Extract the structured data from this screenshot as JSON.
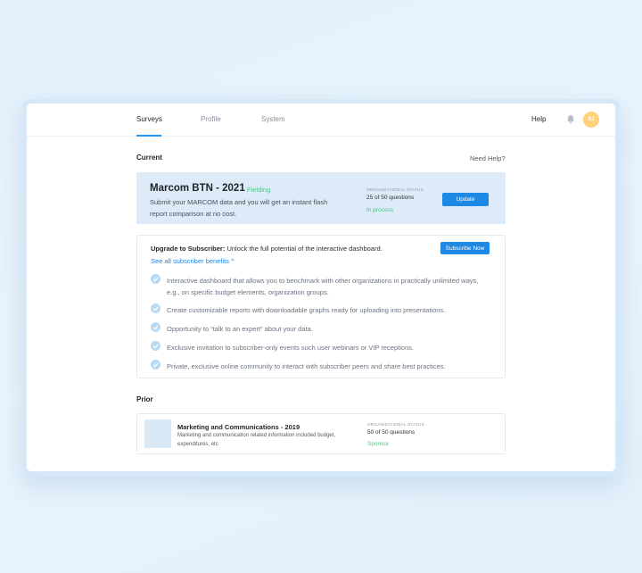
{
  "nav": {
    "tabs": [
      {
        "label": "Surveys",
        "active": true
      },
      {
        "label": "Profile",
        "active": false
      },
      {
        "label": "System",
        "active": false
      }
    ],
    "help": "Help",
    "avatar_initials": "SJ",
    "bell_icon": "bell-icon"
  },
  "current": {
    "section_title": "Current",
    "need_help": "Need Help?",
    "card": {
      "title": "Marcom BTN - 2021",
      "status": "Fielding",
      "description": "Submit your MARCOM data and you will get an instant flash report comparison at no cost.",
      "org_label": "ORGANIZATIONAL STATUS",
      "questions": "25 of 50 questions",
      "org_state": "In process",
      "button": "Update"
    }
  },
  "upgrade": {
    "heading_bold": "Upgrade to Subscriber:",
    "heading_rest": " Unlock the full potential of the interactive dashboard.",
    "button": "Subscribe Now",
    "benefits_link": "See all subscriber benefits ^",
    "benefits": [
      "Interactive dashboard that allows you to benchmark with other organizations in practically unlimited ways, e.g., on specific budget elements, organization groups.",
      "Create customizable reports with downloadable graphs ready for uploading into presentations.",
      "Opportunity to “talk to an expert” about your data.",
      "Exclusive invitation to subscriber-only events such user webinars or VIP receptions.",
      "Private, exclusive online community to interact with subscriber peers and share best practices."
    ]
  },
  "prior": {
    "section_title": "Prior",
    "card": {
      "title": "Marketing and Communications - 2019",
      "description": "Marketing and communication related information included budget, expenditures, etc",
      "org_label": "ORGANIZATIONAL STATUS",
      "questions": "50 of 50 questions",
      "org_state": "Sponsor"
    }
  },
  "colors": {
    "accent": "#1e88e5",
    "success": "#4fc38a",
    "avatar": "#ffd27a",
    "card_highlight": "#dcebf7"
  }
}
